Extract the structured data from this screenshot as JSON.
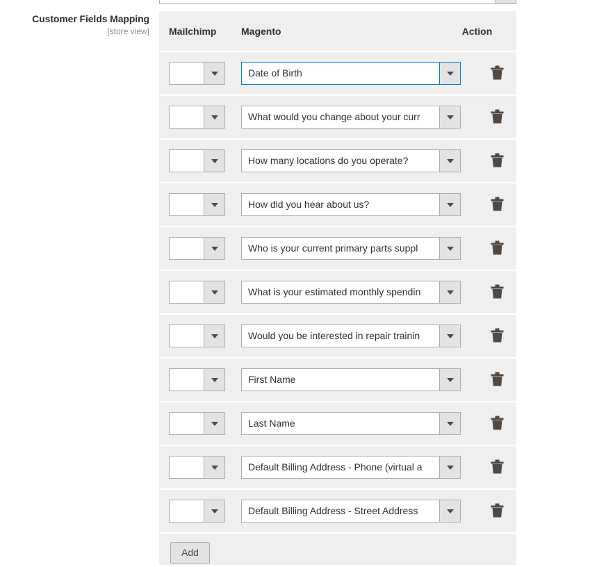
{
  "field": {
    "label": "Customer Fields Mapping",
    "scope": "[store view]"
  },
  "table": {
    "headers": {
      "mailchimp": "Mailchimp",
      "magento": "Magento",
      "action": "Action"
    },
    "rows": [
      {
        "mailchimp": "",
        "magento": "Date of Birth",
        "focused": true,
        "delete_icon": "trash-icon"
      },
      {
        "mailchimp": "",
        "magento": "What would you change about your curr",
        "focused": false,
        "delete_icon": "trash-icon"
      },
      {
        "mailchimp": "",
        "magento": "How many locations do you operate?",
        "focused": false,
        "delete_icon": "trash-icon"
      },
      {
        "mailchimp": "",
        "magento": "How did you hear about us?",
        "focused": false,
        "delete_icon": "trash-icon"
      },
      {
        "mailchimp": "",
        "magento": "Who is your current primary parts suppl",
        "focused": false,
        "delete_icon": "trash-icon"
      },
      {
        "mailchimp": "",
        "magento": "What is your estimated monthly spendin",
        "focused": false,
        "delete_icon": "trash-icon"
      },
      {
        "mailchimp": "",
        "magento": "Would you be interested in repair trainin",
        "focused": false,
        "delete_icon": "trash-icon"
      },
      {
        "mailchimp": "",
        "magento": "First Name",
        "focused": false,
        "delete_icon": "trash-icon"
      },
      {
        "mailchimp": "",
        "magento": "Last Name",
        "focused": false,
        "delete_icon": "trash-icon"
      },
      {
        "mailchimp": "",
        "magento": "Default Billing Address - Phone (virtual a",
        "focused": false,
        "delete_icon": "trash-icon"
      },
      {
        "mailchimp": "",
        "magento": "Default Billing Address - Street Address ",
        "focused": false,
        "delete_icon": "trash-icon"
      }
    ],
    "add_label": "Add"
  },
  "colors": {
    "table_bg": "#efefef",
    "row_divider": "#ffffff",
    "select_border": "#adadad",
    "select_arrow_bg": "#e3e3e3",
    "focus_border": "#007bdb",
    "text": "#303030",
    "scope_text": "#8c8c8c",
    "trash": "#514943",
    "button_text": "#514943"
  }
}
